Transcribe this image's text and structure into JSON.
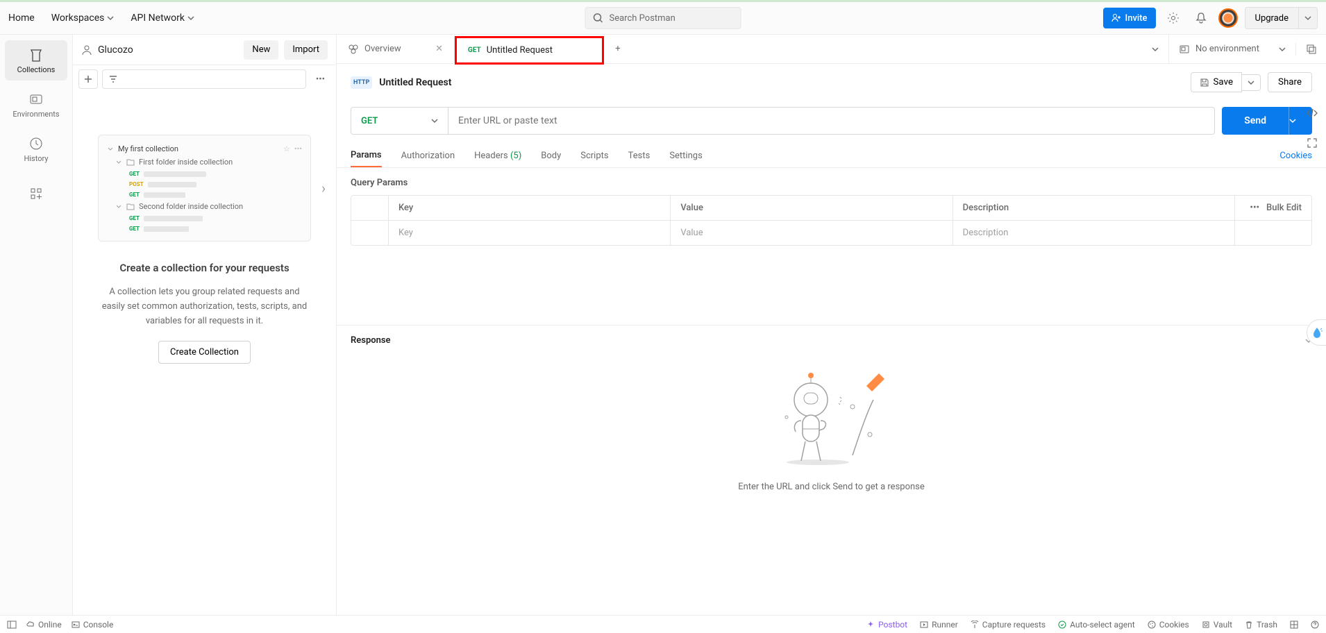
{
  "topnav": {
    "home": "Home",
    "workspaces": "Workspaces",
    "api": "API Network"
  },
  "search_placeholder": "Search Postman",
  "invite": "Invite",
  "upgrade": "Upgrade",
  "workspace": {
    "name": "Glucozo",
    "new": "New",
    "import": "Import"
  },
  "farLeft": {
    "collections": "Collections",
    "environments": "Environments",
    "history": "History"
  },
  "miniCard": {
    "title": "My first collection",
    "folder1": "First folder inside collection",
    "folder2": "Second folder inside collection",
    "m1": "GET",
    "m2": "POST",
    "m3": "GET",
    "m4": "GET",
    "m5": "GET"
  },
  "empty": {
    "title": "Create a collection for your requests",
    "desc": "A collection lets you group related requests and easily set common authorization, tests, scripts, and variables for all requests in it.",
    "button": "Create Collection"
  },
  "tabs": {
    "overview": "Overview",
    "req_method": "GET",
    "req_name": "Untitled Request"
  },
  "env": "No environment",
  "request": {
    "icon": "HTTP",
    "title": "Untitled Request",
    "save": "Save",
    "share": "Share"
  },
  "urlbar": {
    "method": "GET",
    "placeholder": "Enter URL or paste text",
    "send": "Send"
  },
  "reqTabs": {
    "params": "Params",
    "auth": "Authorization",
    "headers": "Headers",
    "headers_count": "(5)",
    "body": "Body",
    "scripts": "Scripts",
    "tests": "Tests",
    "settings": "Settings",
    "cookies": "Cookies"
  },
  "qparams": {
    "title": "Query Params",
    "key": "Key",
    "value": "Value",
    "desc": "Description",
    "bulk": "Bulk Edit",
    "ph_key": "Key",
    "ph_value": "Value",
    "ph_desc": "Description"
  },
  "response": {
    "title": "Response",
    "empty": "Enter the URL and click Send to get a response"
  },
  "footer": {
    "online": "Online",
    "console": "Console",
    "postbot": "Postbot",
    "runner": "Runner",
    "capture": "Capture requests",
    "agent": "Auto-select agent",
    "cookies": "Cookies",
    "vault": "Vault",
    "trash": "Trash"
  }
}
